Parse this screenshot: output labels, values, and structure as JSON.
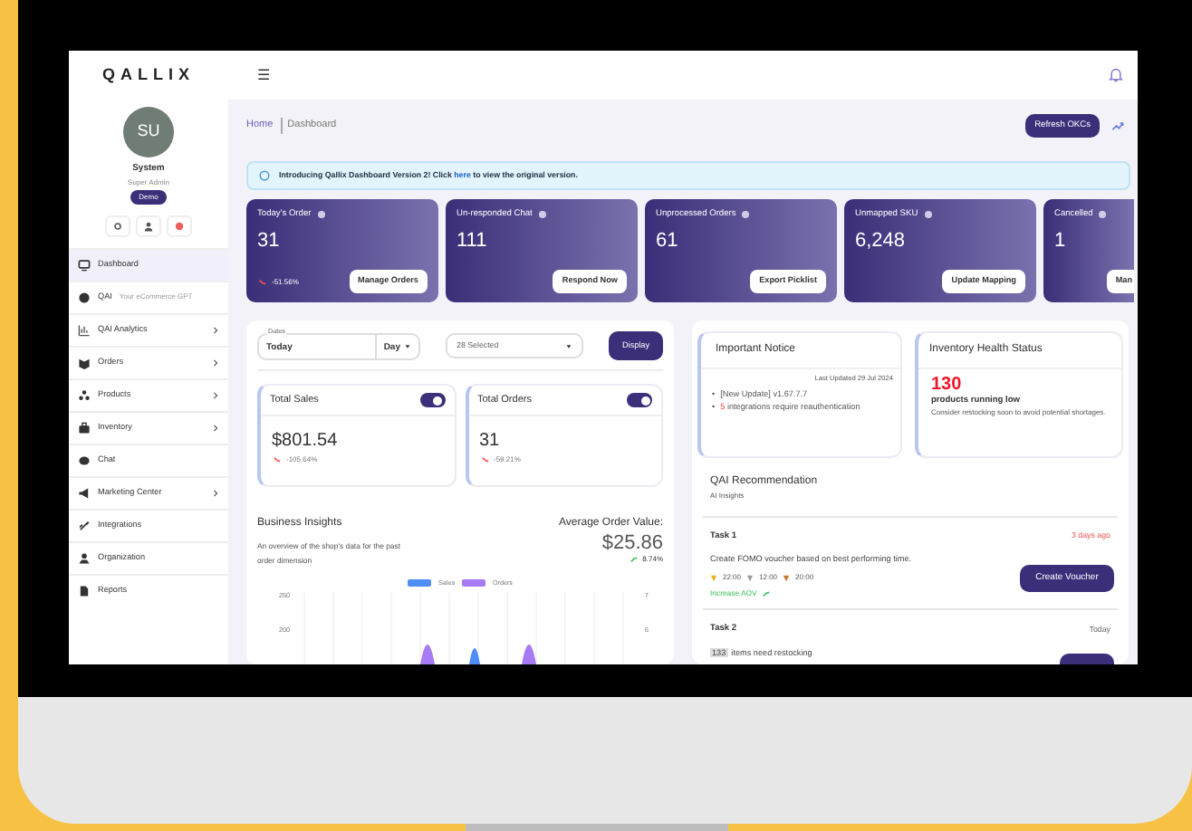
{
  "app": {
    "logo": "QALLIX",
    "menu_glyph": "☰"
  },
  "user": {
    "initials": "SU",
    "name": "System",
    "role": "Super Admin",
    "badge": "Demo"
  },
  "sidebar": {
    "items": [
      {
        "label": "Dashboard",
        "selected": true,
        "submenu": false
      },
      {
        "label": "QAI",
        "note": "Your eCommerce GPT",
        "selected": false,
        "submenu": false
      },
      {
        "label": "QAI Analytics",
        "selected": false,
        "submenu": true
      },
      {
        "label": "Orders",
        "selected": false,
        "submenu": true
      },
      {
        "label": "Products",
        "selected": false,
        "submenu": true
      },
      {
        "label": "Inventory",
        "selected": false,
        "submenu": true
      },
      {
        "label": "Chat",
        "selected": false,
        "submenu": false
      },
      {
        "label": "Marketing Center",
        "selected": false,
        "submenu": true
      },
      {
        "label": "Integrations",
        "selected": false,
        "submenu": false
      },
      {
        "label": "Organization",
        "selected": false,
        "submenu": false
      },
      {
        "label": "Reports",
        "selected": false,
        "submenu": false
      }
    ]
  },
  "breadcrumb": [
    "Home",
    "Dashboard"
  ],
  "refresh_button": "Refresh OKCs",
  "banner": {
    "before": "Introducing Qallix Dashboard Version 2! Click",
    "link": "here",
    "after": "to view the original version."
  },
  "stat_cards": [
    {
      "title": "Today's Order",
      "value": "31",
      "change": "-51.56%",
      "button": "Manage Orders"
    },
    {
      "title": "Un-responded Chat",
      "value": "111",
      "button": "Respond Now"
    },
    {
      "title": "Unprocessed Orders",
      "value": "61",
      "button": "Export Picklist"
    },
    {
      "title": "Unmapped SKU",
      "value": "6,248",
      "button": "Update Mapping"
    },
    {
      "title": "Cancelled",
      "value": "1",
      "button": "Man"
    }
  ],
  "filters": {
    "dates_label": "Dates",
    "dates_value": "Today",
    "period": "Day",
    "shops": "28 Selected",
    "button": "Display"
  },
  "totals": [
    {
      "title": "Total Sales",
      "on": true,
      "value": "$801.54",
      "change": "-105.64%"
    },
    {
      "title": "Total Orders",
      "on": true,
      "value": "31",
      "change": "-59.21%"
    }
  ],
  "insights": {
    "title": "Business Insights",
    "description": "An overview of the shop's data for the past order dimension",
    "aov_label": "Average Order Value:",
    "aov_value": "$25.86",
    "aov_change": "8.74%"
  },
  "chart": {
    "legend": [
      {
        "name": "Sales",
        "color": "#4f8df7"
      },
      {
        "name": "Orders",
        "color": "#a77bf3"
      }
    ],
    "left_ticks": [
      "250",
      "200"
    ],
    "right_ticks": [
      "7",
      "6"
    ]
  },
  "notice": {
    "title": "Important Notice",
    "updated": "Last Updated 29 Jul 2024",
    "items": [
      {
        "bullet": "•",
        "text": "[New Update] v1.67.7.7"
      },
      {
        "bullet": "•",
        "count": "5",
        "text": "integrations require reauthentication"
      }
    ]
  },
  "inventory": {
    "title": "Inventory Health Status",
    "count": "130",
    "headline": "products running low",
    "note": "Consider restocking soon to avoid potential shortages."
  },
  "recommendation": {
    "title": "QAI Recommendation",
    "subtitle": "AI Insights",
    "tasks": [
      {
        "title": "Task 1",
        "when": "3 days ago",
        "urgent": true,
        "text": "Create FOMO voucher based on best performing time.",
        "times": [
          {
            "time": "22:00",
            "color": "#e8b923"
          },
          {
            "time": "12:00",
            "color": "#a0a0a0"
          },
          {
            "time": "20:00",
            "color": "#c07a2c"
          }
        ],
        "goal": "Increase AOV",
        "button": "Create Voucher"
      },
      {
        "title": "Task 2",
        "when": "Today",
        "urgent": false,
        "count": "133",
        "text": "items need restocking"
      }
    ]
  }
}
